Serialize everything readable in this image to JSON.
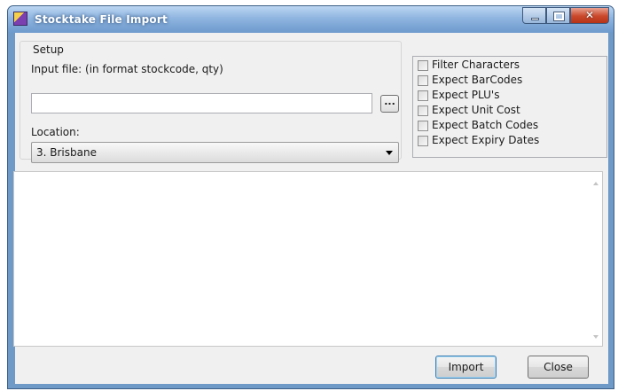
{
  "window": {
    "title": "Stocktake File Import"
  },
  "setup": {
    "legend": "Setup",
    "input_file_label": "Input file: (in format stockcode, qty)",
    "input_file_value": "",
    "browse_label": "...",
    "location_label": "Location:",
    "location_value": "3. Brisbane"
  },
  "options": [
    {
      "label": "Filter Characters",
      "checked": false
    },
    {
      "label": "Expect BarCodes",
      "checked": false
    },
    {
      "label": "Expect PLU's",
      "checked": false
    },
    {
      "label": "Expect Unit Cost",
      "checked": false
    },
    {
      "label": "Expect Batch Codes",
      "checked": false
    },
    {
      "label": "Expect Expiry Dates",
      "checked": false
    }
  ],
  "log": {
    "text": ""
  },
  "buttons": {
    "import": "Import",
    "close": "Close"
  },
  "icons": {
    "app": "stocktake-app-icon",
    "minimize": "minimize-icon",
    "maximize": "maximize-icon",
    "close": "close-icon",
    "dropdown": "chevron-down-icon",
    "scroll_up": "scroll-up-arrow-icon",
    "scroll_down": "scroll-down-arrow-icon"
  }
}
